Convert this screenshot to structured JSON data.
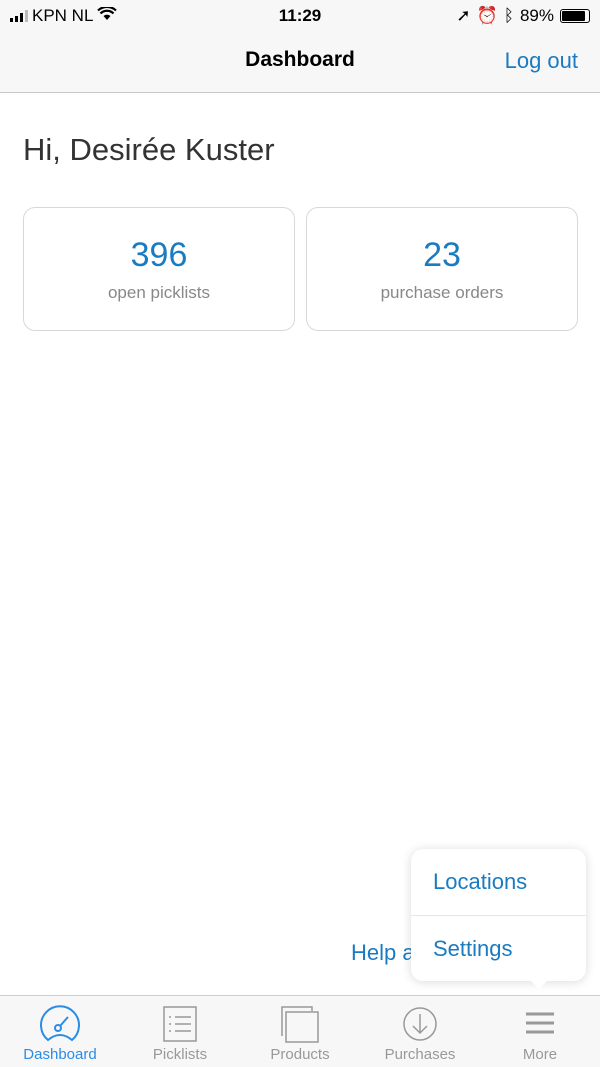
{
  "status_bar": {
    "carrier": "KPN NL",
    "time": "11:29",
    "battery": "89%",
    "battery_level": 0.89
  },
  "nav": {
    "title": "Dashboard",
    "logout_label": "Log out"
  },
  "greeting": "Hi, Desirée Kuster",
  "cards": [
    {
      "value": "396",
      "label": "open picklists"
    },
    {
      "value": "23",
      "label": "purchase orders"
    }
  ],
  "help_text": "Help a",
  "popover": {
    "items": [
      "Locations",
      "Settings"
    ]
  },
  "tabs": [
    {
      "label": "Dashboard",
      "icon": "gauge-icon",
      "active": true
    },
    {
      "label": "Picklists",
      "icon": "list-icon"
    },
    {
      "label": "Products",
      "icon": "stack-icon"
    },
    {
      "label": "Purchases",
      "icon": "download-circle-icon"
    },
    {
      "label": "More",
      "icon": "menu-icon"
    }
  ],
  "colors": {
    "accent": "#1a7bc0",
    "tab_active": "#2b8ce6",
    "tab_inactive": "#999999"
  }
}
